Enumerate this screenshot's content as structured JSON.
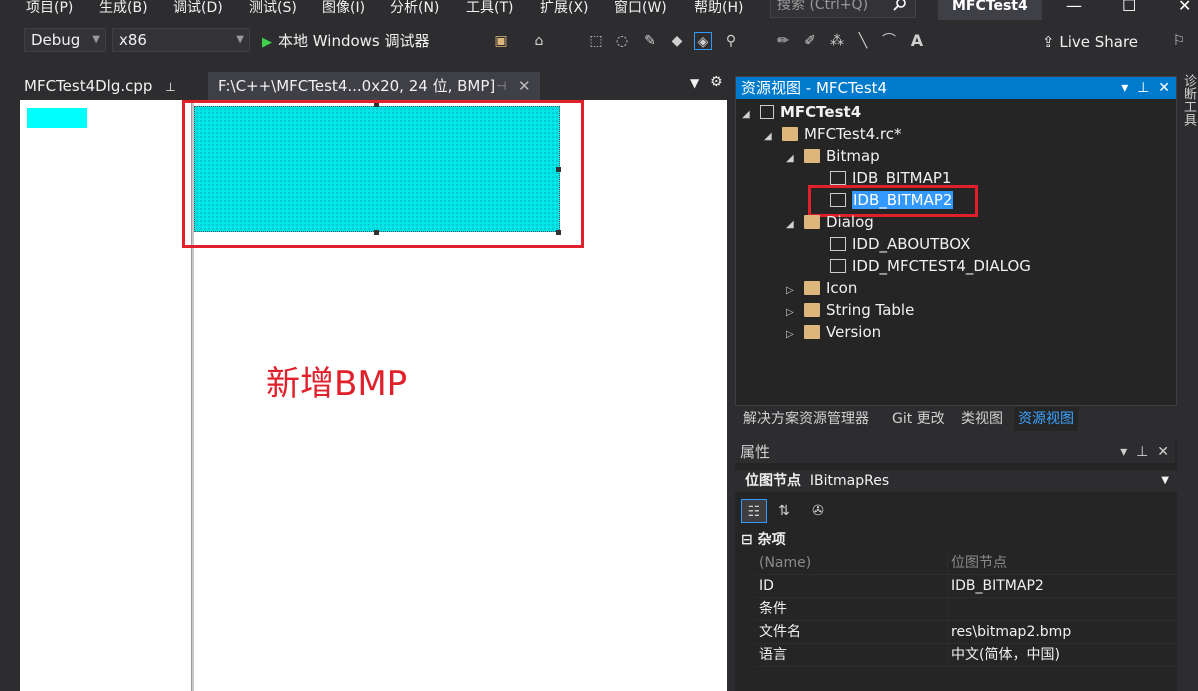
{
  "menu": [
    "项目(P)",
    "生成(B)",
    "调试(D)",
    "测试(S)",
    "图像(I)",
    "分析(N)",
    "工具(T)",
    "扩展(X)",
    "窗口(W)",
    "帮助(H)"
  ],
  "search_placeholder": "搜索 (Ctrl+Q)",
  "app_title": "MFCTest4",
  "toolbar": {
    "config": "Debug",
    "platform": "x86",
    "run_label": "本地 Windows 调试器",
    "live_share": "Live Share"
  },
  "doc_tabs": {
    "tab1": "MFCTest4Dlg.cpp",
    "tab2": "F:\\C++\\MFCTest4...0x20, 24 位, BMP]"
  },
  "annotation": "新增BMP",
  "resource_view": {
    "title": "资源视图 - MFCTest4",
    "project": "MFCTest4",
    "rc_file": "MFCTest4.rc*",
    "bitmap_folder": "Bitmap",
    "bitmap1": "IDB_BITMAP1",
    "bitmap2": "IDB_BITMAP2",
    "dialog_folder": "Dialog",
    "dialog1": "IDD_ABOUTBOX",
    "dialog2": "IDD_MFCTEST4_DIALOG",
    "icon_folder": "Icon",
    "string_folder": "String Table",
    "version_folder": "Version"
  },
  "bottom_tabs": [
    "解决方案资源管理器",
    "Git 更改",
    "类视图",
    "资源视图"
  ],
  "properties": {
    "title": "属性",
    "object_name": "位图节点",
    "object_type": "IBitmapRes",
    "category": "杂项",
    "rows": [
      {
        "key": "(Name)",
        "value": "位图节点"
      },
      {
        "key": "ID",
        "value": "IDB_BITMAP2"
      },
      {
        "key": "条件",
        "value": ""
      },
      {
        "key": "文件名",
        "value": "res\\bitmap2.bmp"
      },
      {
        "key": "语言",
        "value": "中文(简体，中国)"
      }
    ]
  },
  "right_edge_label": "诊断工具",
  "colors": {
    "accent": "#007acc",
    "annotation_red": "#e0202a",
    "bitmap_cyan": "#00e5e8"
  }
}
